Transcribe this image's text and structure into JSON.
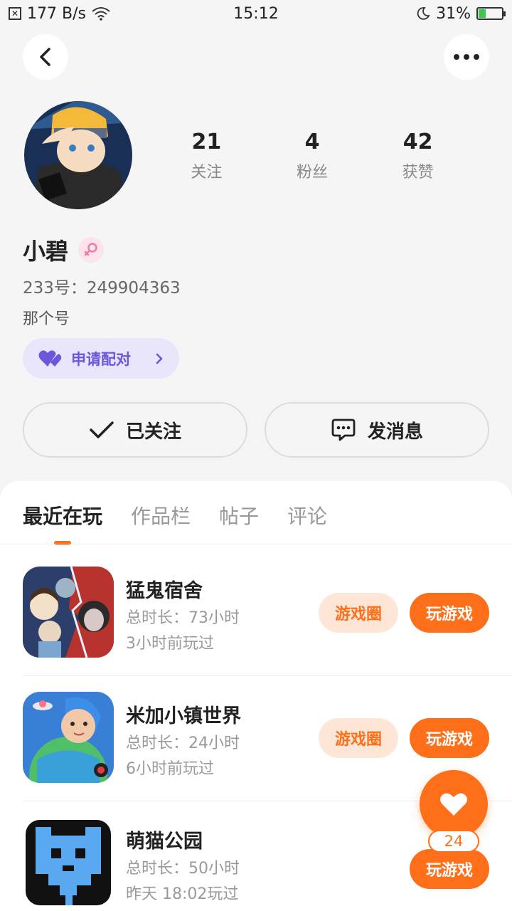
{
  "status_bar": {
    "net_speed": "177 B/s",
    "time": "15:12",
    "battery": "31%",
    "battery_level": 0.31,
    "icons": [
      "sim-icon",
      "wifi-icon",
      "moon-icon",
      "battery-icon"
    ]
  },
  "profile": {
    "stats": [
      {
        "value": "21",
        "label": "关注"
      },
      {
        "value": "4",
        "label": "粉丝"
      },
      {
        "value": "42",
        "label": "获赞"
      }
    ],
    "name": "小碧",
    "uid": "233号：249904363",
    "bio": "那个号",
    "pair_label": "申请配对",
    "follow_label": "已关注",
    "message_label": "发消息"
  },
  "tabs": [
    {
      "label": "最近在玩",
      "active": true
    },
    {
      "label": "作品栏",
      "active": false
    },
    {
      "label": "帖子",
      "active": false
    },
    {
      "label": "评论",
      "active": false
    }
  ],
  "games": [
    {
      "name": "猛鬼宿舍",
      "duration": "总时长：73小时",
      "last_played": "3小时前玩过",
      "circle_label": "游戏圈",
      "play_label": "玩游戏"
    },
    {
      "name": "米加小镇世界",
      "duration": "总时长：24小时",
      "last_played": "6小时前玩过",
      "circle_label": "游戏圈",
      "play_label": "玩游戏"
    },
    {
      "name": "萌猫公园",
      "duration": "总时长：50小时",
      "last_played": "昨天 18:02玩过",
      "play_label": "玩游戏"
    }
  ],
  "like_count": "24",
  "colors": {
    "accent": "#ff6f1a",
    "pair_bg": "#e9e6fb",
    "pair_text": "#6a57d9",
    "gender_badge": "#fde3ec"
  }
}
